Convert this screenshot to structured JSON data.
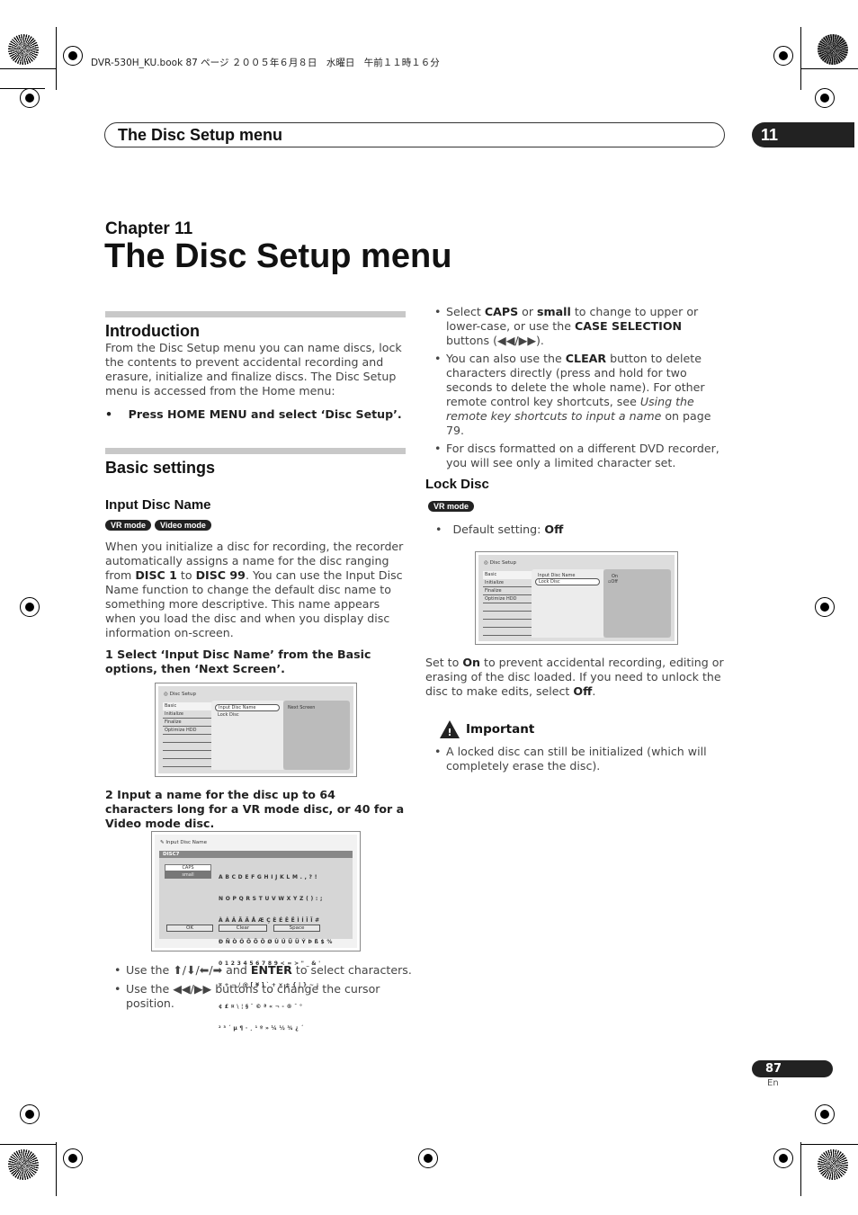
{
  "print_slug": "DVR-530H_KU.book  87 ページ  ２００５年６月８日　水曜日　午前１１時１６分",
  "header": {
    "title": "The Disc Setup menu",
    "chapter_number": "11"
  },
  "chapter": {
    "label": "Chapter 11",
    "title": "The Disc Setup menu"
  },
  "intro": {
    "heading": "Introduction",
    "body": "From the Disc Setup menu you can name discs, lock the contents to prevent accidental recording and erasure, initialize and finalize discs. The Disc Setup menu is accessed from the Home menu:",
    "bullet": "Press HOME MENU and select ‘Disc Setup’."
  },
  "basic": {
    "heading": "Basic settings"
  },
  "input_disc_name": {
    "heading": "Input Disc Name",
    "badges": [
      "VR mode",
      "Video mode"
    ],
    "p1": "When you initialize a disc for recording, the recorder automatically assigns a name for the disc ranging from ",
    "p1_b1": "DISC 1",
    "p1_to": " to ",
    "p1_b2": "DISC 99",
    "p1_rest": ". You can use the Input Disc Name function to change the default disc name to something more descriptive. This name appears when you load the disc and when you display disc information on-screen.",
    "step1": "1    Select ‘Input Disc Name’ from the Basic options, then ‘Next Screen’.",
    "step2": "2    Input a name for the disc up to 64 characters long for a VR mode disc, or 40 for a Video mode disc.",
    "bullets": [
      "Use the ⬆/⬇/⬅/➡ and ",
      "ENTER",
      " to select characters.",
      "Use the ◀◀/▶▶ buttons to change the cursor position."
    ]
  },
  "screen1": {
    "title": "Disc Setup",
    "side": [
      "Basic",
      "Initialize",
      "Finalize",
      "Optimize HDD"
    ],
    "mid": [
      "Input Disc Name",
      "Lock Disc"
    ],
    "right": "Next Screen"
  },
  "screen2": {
    "title": "Input Disc Name",
    "value": "DISC7",
    "modes": [
      "CAPS",
      "small"
    ],
    "rows": [
      "A B C D E F G H I J K L M . , ? !",
      "N O P Q R S T U V W X Y Z ( ) : ;",
      "À Á Â Ã Ä Å Æ Ç È É Ê Ë Ì Í Î Ï #",
      "Ð Ñ Ò Ó Ô Õ Ö Ø Ù Ú Û Ü Ý Þ ß $ %",
      "0 1 2 3 4 5 6 7 8 9 < = > \" _ & '",
      "¤ + − / @ [ ¥ ] ` + × ± { | } ~ ¡",
      "¢ £ ¤ \\ ¦ § ¨ © ª « ¬ - ® ¯ °",
      "² ³ ´ µ ¶ · ¸ ¹ º » ¼ ½ ¾ ¿ ´"
    ],
    "buttons": [
      "OK",
      "Clear",
      "Space"
    ]
  },
  "right_bullets": [
    {
      "pre": "Select ",
      "b1": "CAPS",
      "mid": " or ",
      "b2": "small",
      "post": " to change to upper or lower-case, or use the ",
      "b3": "CASE SELECTION",
      "end": " buttons (◀◀/▶▶)."
    },
    {
      "pre": "You can also use the ",
      "b1": "CLEAR",
      "post": " button to delete characters directly (press and hold for two seconds to delete the whole name). For other remote control key shortcuts, see ",
      "i": "Using the remote key shortcuts to input a name",
      "end": " on page 79."
    },
    {
      "text": "For discs formatted on a different DVD recorder, you will see only a limited character set."
    }
  ],
  "lock_disc": {
    "heading": "Lock Disc",
    "badge": "VR mode",
    "default_pre": "Default setting: ",
    "default_val": "Off",
    "p_pre": "Set to ",
    "p_on": "On",
    "p_mid": " to prevent accidental recording, editing or erasing of the disc loaded. If you need to unlock the disc to make edits, select ",
    "p_off": "Off",
    "p_end": "."
  },
  "screen3": {
    "title": "Disc Setup",
    "side": [
      "Basic",
      "Initialize",
      "Finalize",
      "Optimize HDD"
    ],
    "mid": [
      "Input Disc Name",
      "Lock Disc"
    ],
    "right": [
      "On",
      "Off"
    ]
  },
  "important": {
    "heading": "Important",
    "bullet": "A locked disc can still be initialized (which will completely erase the disc)."
  },
  "footer": {
    "page": "87",
    "lang": "En"
  }
}
